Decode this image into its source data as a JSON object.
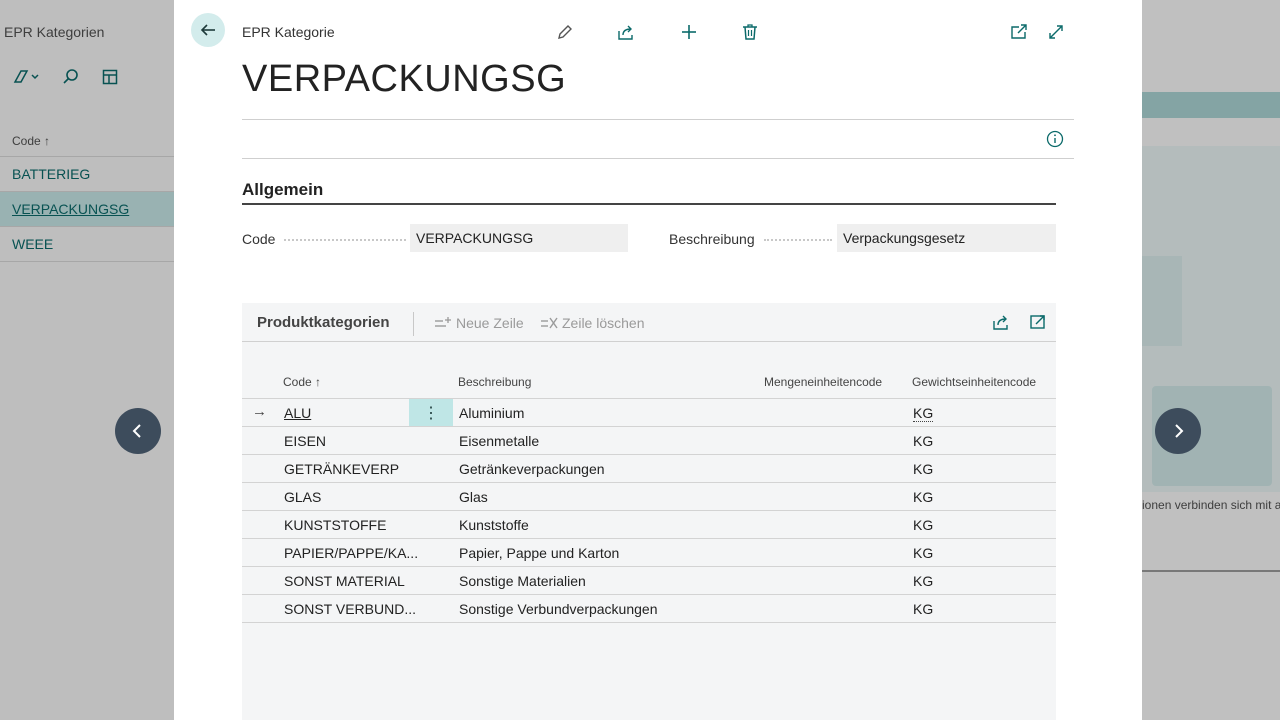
{
  "background": {
    "page_title": "EPR Kategorien",
    "list_header": "Code ↑",
    "list_items": [
      "BATTERIEG",
      "VERPACKUNGSG",
      "WEEE"
    ],
    "selected_index": 1,
    "right_caption": "ionen verbinden sich mit a"
  },
  "dialog": {
    "entity_label": "EPR Kategorie",
    "title": "VERPACKUNGSG",
    "general": {
      "section_title": "Allgemein",
      "code_label": "Code",
      "code_value": "VERPACKUNGSG",
      "description_label": "Beschreibung",
      "description_value": "Verpackungsgesetz"
    },
    "subpage": {
      "title": "Produktkategorien",
      "new_line": "Neue Zeile",
      "delete_line": "Zeile löschen",
      "columns": {
        "code": "Code ↑",
        "description": "Beschreibung",
        "qty_uom": "Mengeneinheitencode",
        "weight_uom": "Gewichtseinheitencode"
      },
      "rows": [
        {
          "code": "ALU",
          "description": "Aluminium",
          "qty_uom": "",
          "weight_uom": "KG"
        },
        {
          "code": "EISEN",
          "description": "Eisenmetalle",
          "qty_uom": "",
          "weight_uom": "KG"
        },
        {
          "code": "GETRÄNKEVERP",
          "description": "Getränkeverpackungen",
          "qty_uom": "",
          "weight_uom": "KG"
        },
        {
          "code": "GLAS",
          "description": "Glas",
          "qty_uom": "",
          "weight_uom": "KG"
        },
        {
          "code": "KUNSTSTOFFE",
          "description": "Kunststoffe",
          "qty_uom": "",
          "weight_uom": "KG"
        },
        {
          "code": "PAPIER/PAPPE/KA...",
          "description": "Papier, Pappe und Karton",
          "qty_uom": "",
          "weight_uom": "KG"
        },
        {
          "code": "SONST MATERIAL",
          "description": "Sonstige Materialien",
          "qty_uom": "",
          "weight_uom": "KG"
        },
        {
          "code": "SONST VERBUND...",
          "description": "Sonstige Verbundverpackungen",
          "qty_uom": "",
          "weight_uom": "KG"
        }
      ],
      "active_row": 0
    }
  },
  "icons": {
    "back": "arrow-left-icon",
    "edit": "pencil-icon",
    "share": "share-icon",
    "new": "plus-icon",
    "delete": "trash-icon",
    "open_new_window": "open-in-new-window-icon",
    "expand": "expand-icon",
    "info": "info-icon",
    "prev": "chevron-left-icon",
    "next": "chevron-right-icon"
  },
  "colors": {
    "accent": "#0b6a6a",
    "selected_row": "#bfe6e6",
    "nav_button": "#3d4c5c"
  }
}
